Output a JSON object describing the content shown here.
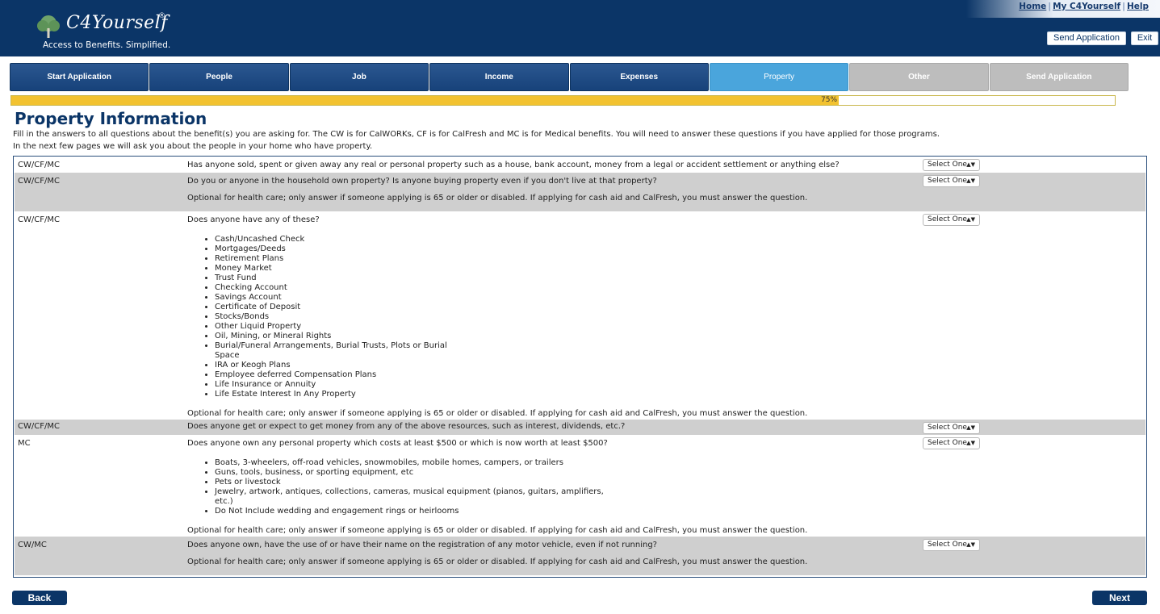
{
  "header": {
    "app_name": "C4Yourself",
    "reg_mark": "®",
    "tagline": "Access to Benefits.  Simplified.",
    "links": {
      "home": "Home",
      "my_account": "My C4Yourself",
      "help": "Help"
    },
    "link_separator": "|",
    "send_application": "Send Application",
    "exit": "Exit",
    "brand_color": "#0b3567"
  },
  "tabs": [
    {
      "label": "Start Application",
      "state": "done"
    },
    {
      "label": "People",
      "state": "done"
    },
    {
      "label": "Job",
      "state": "done"
    },
    {
      "label": "Income",
      "state": "done"
    },
    {
      "label": "Expenses",
      "state": "done"
    },
    {
      "label": "Property",
      "state": "active"
    },
    {
      "label": "Other",
      "state": "future"
    },
    {
      "label": "Send Application",
      "state": "future"
    }
  ],
  "progress": {
    "value": 0.75,
    "label": "75%"
  },
  "page": {
    "title": "Property Information",
    "intro_1": "Fill in the answers to all questions about the benefit(s) you are asking for. The CW is for CalWORKs, CF is for CalFresh and MC is for Medical benefits. You will need to answer these questions if you have applied for those programs.",
    "intro_2": "In the next few pages we will ask you about the people in your home who have property."
  },
  "optional_note": "Optional for health care; only answer if someone applying is 65 or older or disabled. If applying for cash aid and CalFresh, you must answer the question.",
  "select_placeholder": "Select One",
  "questions": [
    {
      "programs": "CW/CF/MC",
      "text": "Has anyone sold, spent or given away any real or personal property such as a house, bank account, money from a legal or accident settlement or anything else?"
    },
    {
      "programs": "CW/CF/MC",
      "text": "Do you or anyone in the household own property? Is anyone buying property even if you don't live at that property?"
    },
    {
      "programs": "CW/CF/MC",
      "text": "Does anyone have any of these?",
      "items": [
        "Cash/Uncashed Check",
        "Mortgages/Deeds",
        "Retirement Plans",
        "Money Market",
        "Trust Fund",
        "Checking Account",
        "Savings Account",
        "Certificate of Deposit",
        "Stocks/Bonds",
        "Other Liquid Property",
        "Oil, Mining, or Mineral Rights",
        "Burial/Funeral Arrangements, Burial Trusts, Plots or Burial Space",
        "IRA or Keogh Plans",
        "Employee deferred Compensation Plans",
        "Life Insurance or Annuity",
        "Life Estate Interest In Any Property"
      ]
    },
    {
      "programs": "CW/CF/MC",
      "text": "Does anyone get or expect to get money from any of the above resources, such as interest, dividends, etc.?"
    },
    {
      "programs": "MC",
      "text": "Does anyone own any personal property which costs at least $500 or which is now worth at least $500?",
      "items": [
        "Boats, 3-wheelers, off-road vehicles, snowmobiles, mobile homes, campers, or trailers",
        "Guns, tools, business, or sporting equipment, etc",
        "Pets or livestock",
        "Jewelry, artwork, antiques, collections, cameras, musical equipment (pianos, guitars, amplifiers, etc.)",
        "Do Not Include wedding and engagement rings or heirlooms"
      ]
    },
    {
      "programs": "CW/MC",
      "text": "Does anyone own, have the use of or have their name on the registration of any motor vehicle, even if not running?"
    }
  ],
  "nav": {
    "back": "Back",
    "next": "Next"
  }
}
